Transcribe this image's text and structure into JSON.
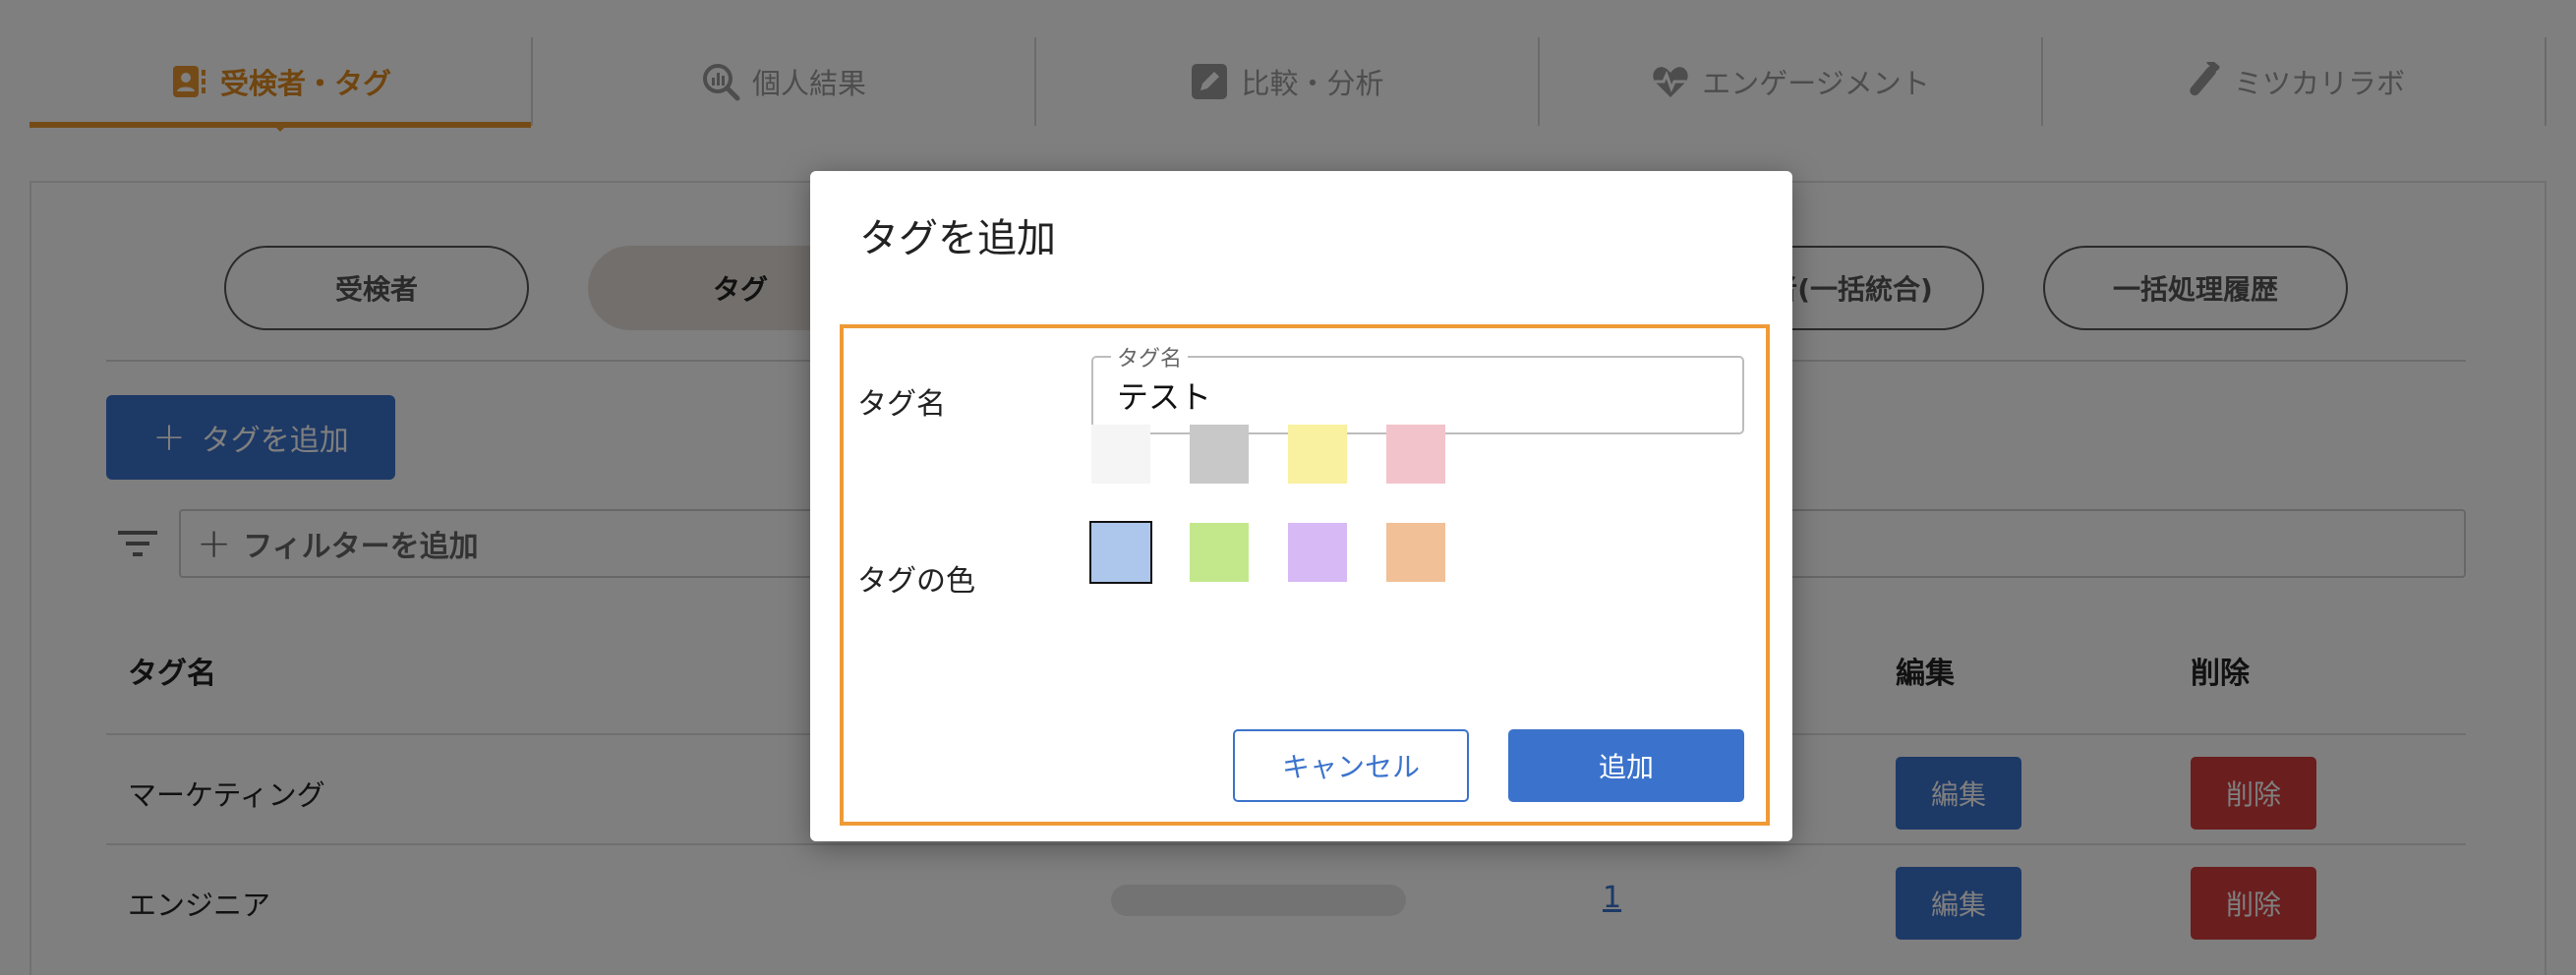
{
  "nav": {
    "tabs": [
      {
        "label": "受検者・タグ",
        "icon": "user-tag-icon",
        "active": true
      },
      {
        "label": "個人結果",
        "icon": "search-chart-icon",
        "active": false
      },
      {
        "label": "比較・分析",
        "icon": "edit-icon",
        "active": false
      },
      {
        "label": "エンゲージメント",
        "icon": "heartbeat-icon",
        "active": false
      },
      {
        "label": "ミツカリラボ",
        "icon": "test-tube-icon",
        "active": false
      }
    ]
  },
  "subtabs": [
    {
      "label": "受検者",
      "active": false
    },
    {
      "label": "タグ",
      "active": true
    },
    {
      "label": "者(一括統合)",
      "active": false
    },
    {
      "label": "一括処理履歴",
      "active": false
    }
  ],
  "toolbar": {
    "add_tag": "タグを追加",
    "filter_placeholder": "フィルターを追加"
  },
  "table": {
    "headers": {
      "name": "タグ名",
      "edit": "編集",
      "delete": "削除"
    },
    "rows": [
      {
        "name": "マーケティング",
        "count": "",
        "edit": "編集",
        "delete": "削除"
      },
      {
        "name": "エンジニア",
        "count": "1",
        "edit": "編集",
        "delete": "削除"
      }
    ]
  },
  "dialog": {
    "title": "タグを追加",
    "name_label": "タグ名",
    "name_field_legend": "タグ名",
    "name_value": "テスト",
    "color_label": "タグの色",
    "colors": [
      "#f5f5f5",
      "#c8c8c8",
      "#f9f0a0",
      "#f3c3cb",
      "#acc6ec",
      "#c3e88c",
      "#d6b9f5",
      "#f1c096"
    ],
    "selected_color_index": 4,
    "cancel": "キャンセル",
    "submit": "追加"
  },
  "colors": {
    "accent": "#e8962e",
    "primary": "#3b73cc",
    "danger": "#d63c3c",
    "highlight": "#ef9a36"
  }
}
